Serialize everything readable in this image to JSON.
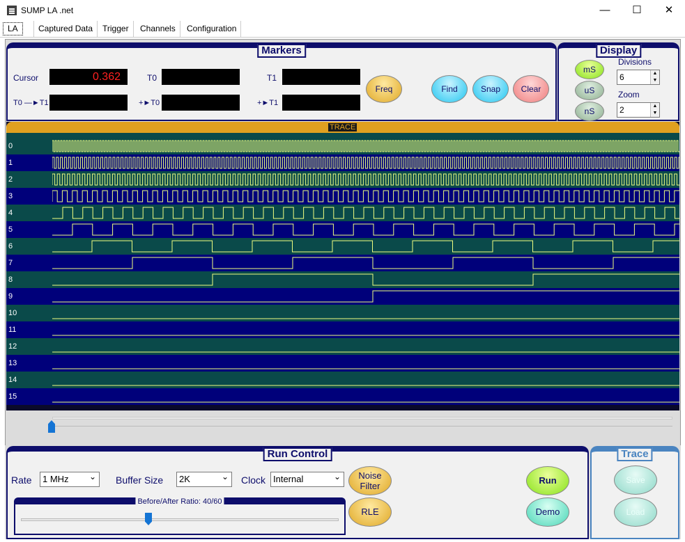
{
  "window": {
    "title": "SUMP LA .net",
    "min_icon": "minimize-icon",
    "max_icon": "maximize-icon",
    "close_icon": "close-icon",
    "min": "—",
    "max": "☐",
    "close": "✕"
  },
  "tabs": [
    "LA",
    "Captured Data",
    "Trigger",
    "Channels",
    "Configuration"
  ],
  "markers": {
    "title": "Markers",
    "cursor_label": "Cursor",
    "cursor_value": "0.362",
    "t0_label": "T0",
    "t1_label": "T1",
    "t0t1_label": "T0 —►T1",
    "pt0_label": "+►T0",
    "pt1_label": "+►T1",
    "freq": "Freq",
    "find": "Find",
    "snap": "Snap",
    "clear": "Clear"
  },
  "display": {
    "title": "Display",
    "units": [
      "mS",
      "uS",
      "nS"
    ],
    "selected_unit": "mS",
    "divisions_label": "Divisions",
    "divisions": "6",
    "zoom_label": "Zoom",
    "zoom": "2"
  },
  "trace": {
    "header": "TRACE",
    "channels": [
      "0",
      "1",
      "2",
      "3",
      "4",
      "5",
      "6",
      "7",
      "8",
      "9",
      "10",
      "11",
      "12",
      "13",
      "14",
      "15"
    ],
    "colors": {
      "teal": "#0a4a4a",
      "blue": "#00007a",
      "signal": "#f0ff80"
    }
  },
  "run_control": {
    "title": "Run Control",
    "rate_label": "Rate",
    "rate": "1 MHz",
    "buffer_label": "Buffer Size",
    "buffer": "2K",
    "clock_label": "Clock",
    "clock": "Internal",
    "ratio_label": "Before/After Ratio: 40/60",
    "ratio_value": 0.4,
    "noise_filter": "Noise Filter",
    "rle": "RLE",
    "run": "Run",
    "demo": "Demo"
  },
  "trace_panel": {
    "title": "Trace",
    "save": "Save",
    "load": "Load"
  }
}
